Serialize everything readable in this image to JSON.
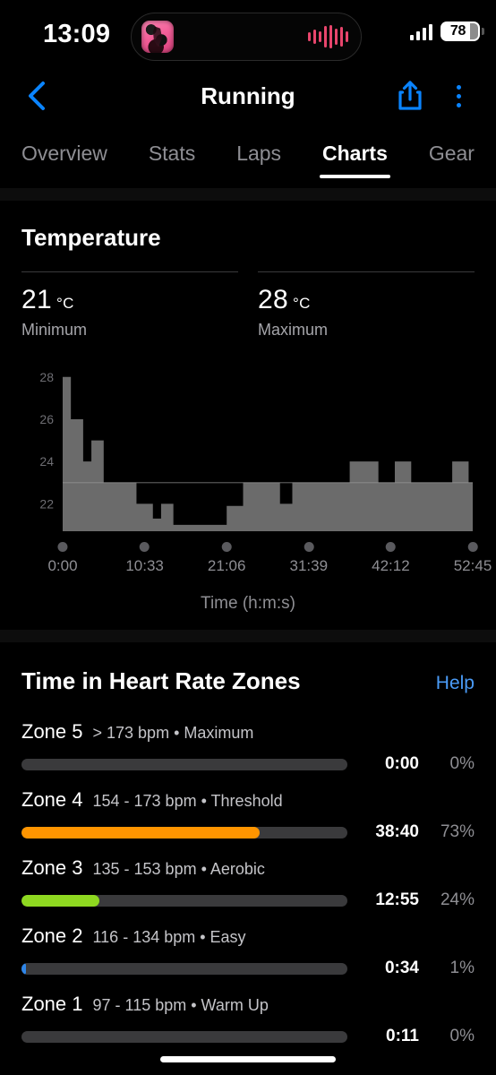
{
  "status_bar": {
    "time": "13:09",
    "battery_level": "78",
    "signal_bars": 4,
    "album_art_icon": "album-artwork",
    "waveform_icon": "audio-waveform-icon",
    "waveform_color": "#e8456c",
    "waveform_bars": [
      10,
      16,
      12,
      24,
      26,
      18,
      22,
      12
    ]
  },
  "nav": {
    "back_icon": "chevron-left-icon",
    "title": "Running",
    "share_icon": "share-icon",
    "more_icon": "more-vertical-icon",
    "accent": "#0a84ff"
  },
  "tabs": [
    {
      "label": "Overview",
      "active": false
    },
    {
      "label": "Stats",
      "active": false
    },
    {
      "label": "Laps",
      "active": false
    },
    {
      "label": "Charts",
      "active": true
    },
    {
      "label": "Gear",
      "active": false
    }
  ],
  "temperature": {
    "title": "Temperature",
    "stats": [
      {
        "value": "21",
        "unit": "°C",
        "label": "Minimum"
      },
      {
        "value": "28",
        "unit": "°C",
        "label": "Maximum"
      }
    ]
  },
  "chart_data": {
    "type": "area",
    "title": "Temperature",
    "xlabel": "Time (h:m:s)",
    "ylabel": "",
    "series_color": "#6b6b6b",
    "grid": false,
    "legend": null,
    "ylim": [
      20.7,
      28.5
    ],
    "yticks": [
      22,
      24,
      26,
      28
    ],
    "ytick_labels": [
      "22",
      "24",
      "26",
      "28"
    ],
    "xlim": [
      0,
      3165
    ],
    "xticks": [
      0,
      633,
      1266,
      1899,
      2532,
      3165
    ],
    "xtick_labels": [
      "0:00",
      "10:33",
      "21:06",
      "31:39",
      "42:12",
      "52:45"
    ],
    "x_seconds": [
      0,
      60,
      120,
      190,
      250,
      310,
      370,
      430,
      500,
      560,
      640,
      700,
      790,
      850,
      920,
      980,
      1050,
      1130,
      1190,
      1270,
      1340,
      1420,
      1500,
      1570,
      1650,
      1720,
      1800,
      1870,
      1950,
      2030,
      2100,
      2180,
      2250,
      2330,
      2420,
      2500,
      2580,
      2660,
      2740,
      2830,
      2910,
      2990,
      3070,
      3165
    ],
    "values": [
      28,
      28,
      26,
      26,
      24,
      24,
      25,
      25,
      23,
      23,
      23,
      22,
      22,
      21.3,
      21.3,
      22,
      22,
      21,
      21,
      21,
      21,
      21,
      21,
      21.8,
      21.8,
      23,
      23,
      23,
      22,
      22,
      23,
      23,
      24,
      24,
      23,
      23,
      24,
      24,
      23,
      23,
      23,
      23,
      24,
      24
    ],
    "steps": [
      {
        "x0": 0,
        "x1": 2,
        "v": 28
      },
      {
        "x0": 2,
        "x1": 5,
        "v": 26
      },
      {
        "x0": 5,
        "x1": 7,
        "v": 24
      },
      {
        "x0": 7,
        "x1": 10,
        "v": 25
      },
      {
        "x0": 10,
        "x1": 18,
        "v": 23
      },
      {
        "x0": 18,
        "x1": 22,
        "v": 22
      },
      {
        "x0": 22,
        "x1": 24,
        "v": 21.3
      },
      {
        "x0": 24,
        "x1": 27,
        "v": 22
      },
      {
        "x0": 27,
        "x1": 40,
        "v": 21
      },
      {
        "x0": 40,
        "x1": 44,
        "v": 21.9
      },
      {
        "x0": 44,
        "x1": 53,
        "v": 23
      },
      {
        "x0": 53,
        "x1": 56,
        "v": 22
      },
      {
        "x0": 56,
        "x1": 70,
        "v": 23
      },
      {
        "x0": 70,
        "x1": 77,
        "v": 24
      },
      {
        "x0": 77,
        "x1": 81,
        "v": 23
      },
      {
        "x0": 81,
        "x1": 85,
        "v": 24
      },
      {
        "x0": 85,
        "x1": 95,
        "v": 23
      },
      {
        "x0": 95,
        "x1": 99,
        "v": 24
      },
      {
        "x0": 99,
        "x1": 100,
        "v": 23
      }
    ]
  },
  "heart_rate_zones": {
    "title": "Time in Heart Rate Zones",
    "help_label": "Help",
    "zones": [
      {
        "name": "Zone 5",
        "range": "> 173 bpm • Maximum",
        "time": "0:00",
        "percent": "0%",
        "fill_pct": 0,
        "color": "#ff3b30"
      },
      {
        "name": "Zone 4",
        "range": "154 - 173 bpm • Threshold",
        "time": "38:40",
        "percent": "73%",
        "fill_pct": 73,
        "color": "#ff9500"
      },
      {
        "name": "Zone 3",
        "range": "135 - 153 bpm • Aerobic",
        "time": "12:55",
        "percent": "24%",
        "fill_pct": 24,
        "color": "#8ed820"
      },
      {
        "name": "Zone 2",
        "range": "116 - 134 bpm • Easy",
        "time": "0:34",
        "percent": "1%",
        "fill_pct": 1.4,
        "color": "#2f86e8"
      },
      {
        "name": "Zone 1",
        "range": "97 - 115 bpm • Warm Up",
        "time": "0:11",
        "percent": "0%",
        "fill_pct": 0,
        "color": "#5ac8fa"
      }
    ]
  },
  "home_indicator": "home-indicator"
}
